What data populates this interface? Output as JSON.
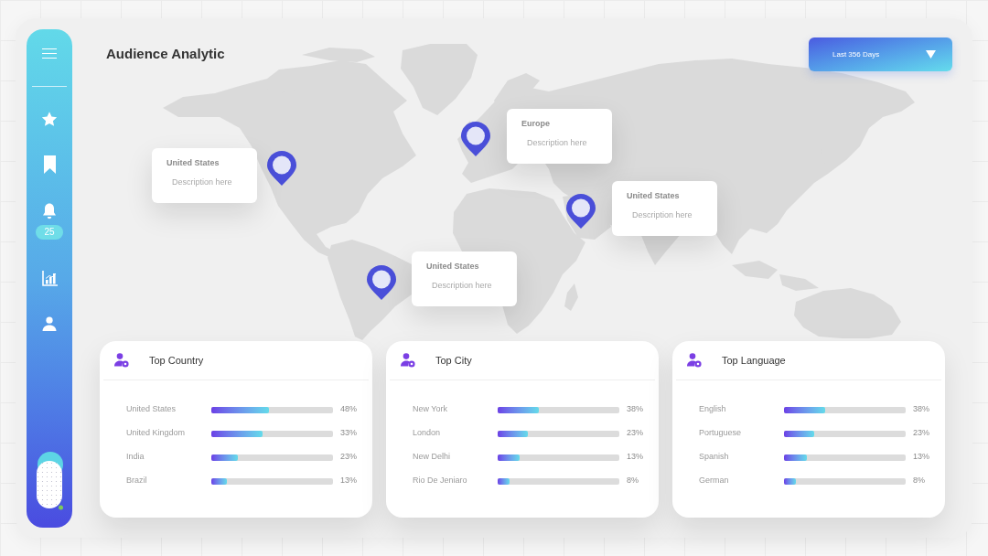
{
  "sidebar": {
    "notification_count": "25"
  },
  "header": {
    "title": "Audience Analytic",
    "date_range": "Last 356 Days"
  },
  "map_callouts": [
    {
      "title": "United States",
      "description": "Description here"
    },
    {
      "title": "Europe",
      "description": "Description here"
    },
    {
      "title": "United States",
      "description": "Description here"
    },
    {
      "title": "United States",
      "description": "Description here"
    }
  ],
  "cards": [
    {
      "title": "Top Country",
      "rows": [
        {
          "label": "United States",
          "level": 0.47,
          "reading": "48%"
        },
        {
          "label": "United Kingdom",
          "level": 0.42,
          "reading": "33%"
        },
        {
          "label": "India",
          "level": 0.22,
          "reading": "23%"
        },
        {
          "label": "Brazil",
          "level": 0.13,
          "reading": "13%"
        }
      ]
    },
    {
      "title": "Top City",
      "rows": [
        {
          "label": "New York",
          "level": 0.34,
          "reading": "38%"
        },
        {
          "label": "London",
          "level": 0.25,
          "reading": "23%"
        },
        {
          "label": "New Delhi",
          "level": 0.18,
          "reading": "13%"
        },
        {
          "label": "Rio De Jeniaro",
          "level": 0.1,
          "reading": "8%"
        }
      ]
    },
    {
      "title": "Top Language",
      "rows": [
        {
          "label": "English",
          "level": 0.34,
          "reading": "38%"
        },
        {
          "label": "Portuguese",
          "level": 0.25,
          "reading": "23%"
        },
        {
          "label": "Spanish",
          "level": 0.19,
          "reading": "13%"
        },
        {
          "label": "German",
          "level": 0.1,
          "reading": "8%"
        }
      ]
    }
  ]
}
